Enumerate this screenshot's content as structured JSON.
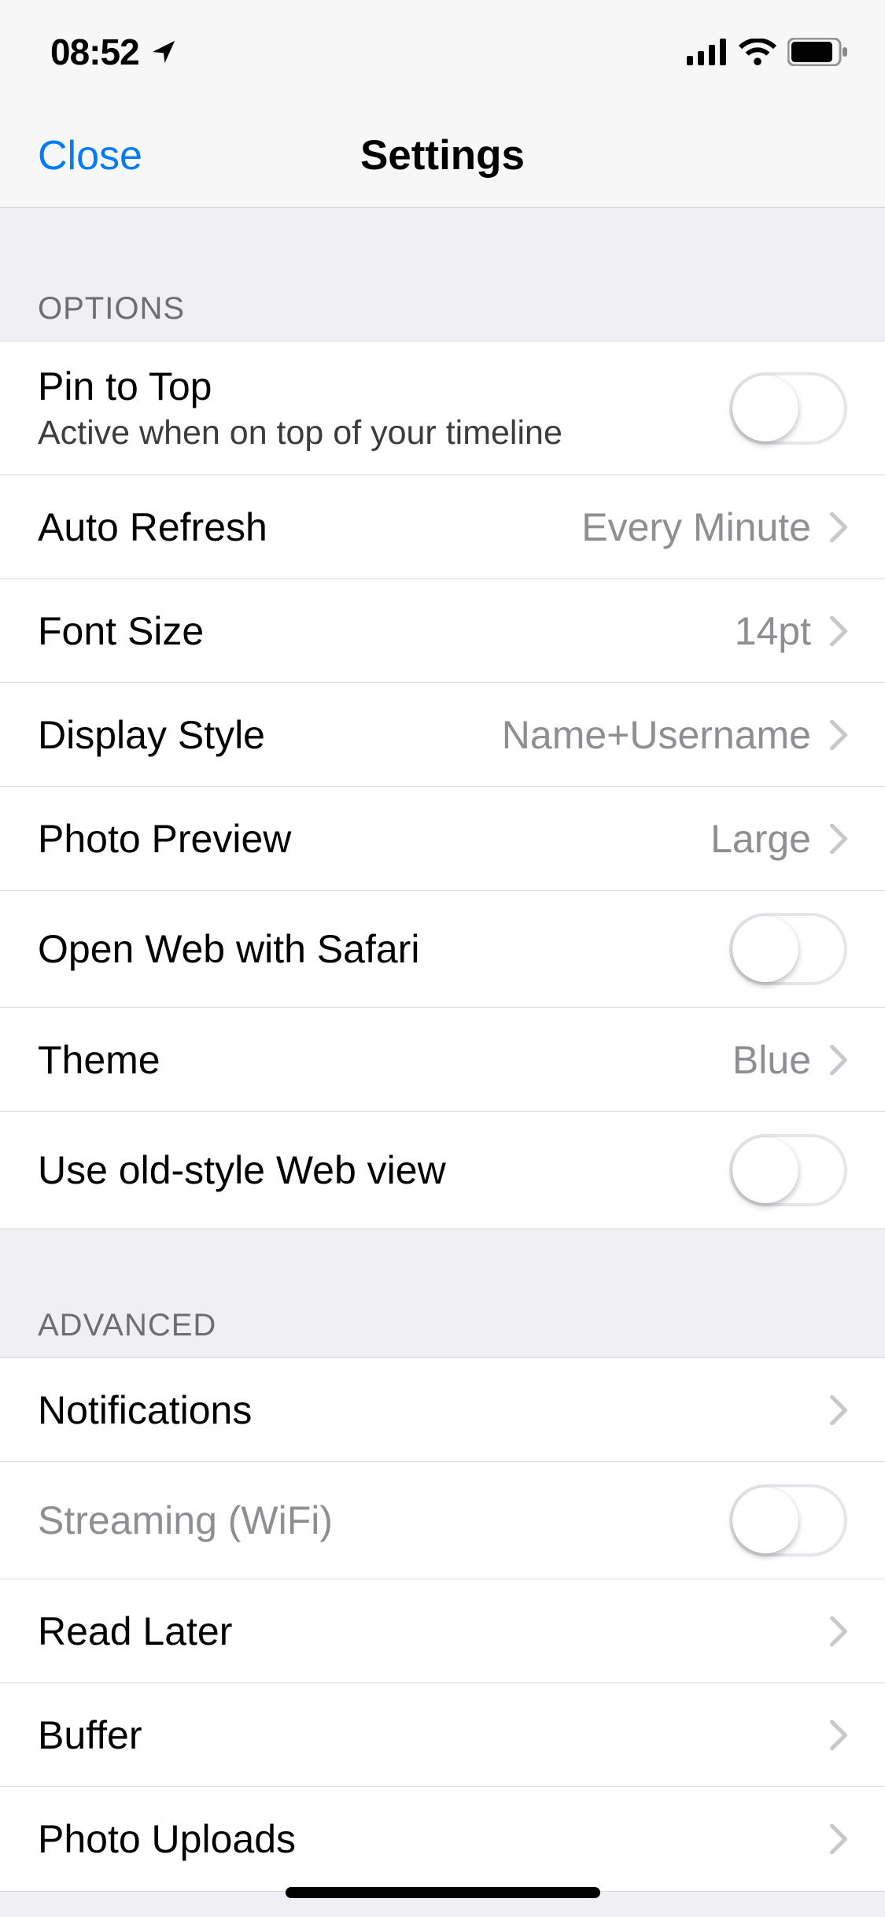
{
  "status": {
    "time": "08:52"
  },
  "nav": {
    "close": "Close",
    "title": "Settings"
  },
  "sections": {
    "options": {
      "header": "OPTIONS",
      "pin_to_top": {
        "label": "Pin to Top",
        "subtitle": "Active when on top of your timeline",
        "on": false
      },
      "auto_refresh": {
        "label": "Auto Refresh",
        "value": "Every Minute"
      },
      "font_size": {
        "label": "Font Size",
        "value": "14pt"
      },
      "display_style": {
        "label": "Display Style",
        "value": "Name+Username"
      },
      "photo_preview": {
        "label": "Photo Preview",
        "value": "Large"
      },
      "open_web_safari": {
        "label": "Open Web with Safari",
        "on": false
      },
      "theme": {
        "label": "Theme",
        "value": "Blue"
      },
      "old_webview": {
        "label": "Use old-style Web view",
        "on": false
      }
    },
    "advanced": {
      "header": "ADVANCED",
      "notifications": {
        "label": "Notifications"
      },
      "streaming": {
        "label": "Streaming (WiFi)",
        "on": false,
        "muted": true
      },
      "read_later": {
        "label": "Read Later"
      },
      "buffer": {
        "label": "Buffer"
      },
      "photo_uploads": {
        "label": "Photo Uploads"
      }
    }
  }
}
